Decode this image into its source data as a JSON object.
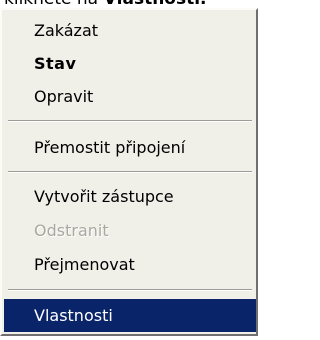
{
  "header_fragment": {
    "prefix": "klikněte na ",
    "bold": "Vlastnosti."
  },
  "context_menu": {
    "items": [
      {
        "label": "Zakázat"
      },
      {
        "label": "Stav"
      },
      {
        "label": "Opravit"
      },
      {
        "label": "Přemostit připojení"
      },
      {
        "label": "Vytvořit zástupce"
      },
      {
        "label": "Odstranit"
      },
      {
        "label": "Přejmenovat"
      },
      {
        "label": "Vlastnosti"
      }
    ]
  },
  "colors": {
    "menu_background": "#f0efe8",
    "selection_highlight": "#0a246a",
    "disabled_text": "#a9a9a2"
  }
}
